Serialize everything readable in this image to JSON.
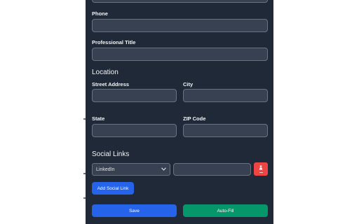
{
  "form": {
    "phone_label": "Phone",
    "phone_value": "",
    "title_label": "Professional Title",
    "title_value": "",
    "location_heading": "Location",
    "street_label": "Street Address",
    "street_value": "",
    "city_label": "City",
    "city_value": "",
    "state_label": "State",
    "state_value": "",
    "zip_label": "ZIP Code",
    "zip_value": "",
    "social_heading": "Social Links",
    "social_platform": "LinkedIn",
    "social_url": "",
    "remove_icon": "person-icon",
    "add_social_label": "Add Social Link",
    "save_label": "Save",
    "autofill_label": "Auto-Fill"
  },
  "colors": {
    "panel_bg": "#1f2937",
    "input_bg": "#374151",
    "primary": "#2563eb",
    "success": "#059669",
    "danger": "#ef4444"
  }
}
